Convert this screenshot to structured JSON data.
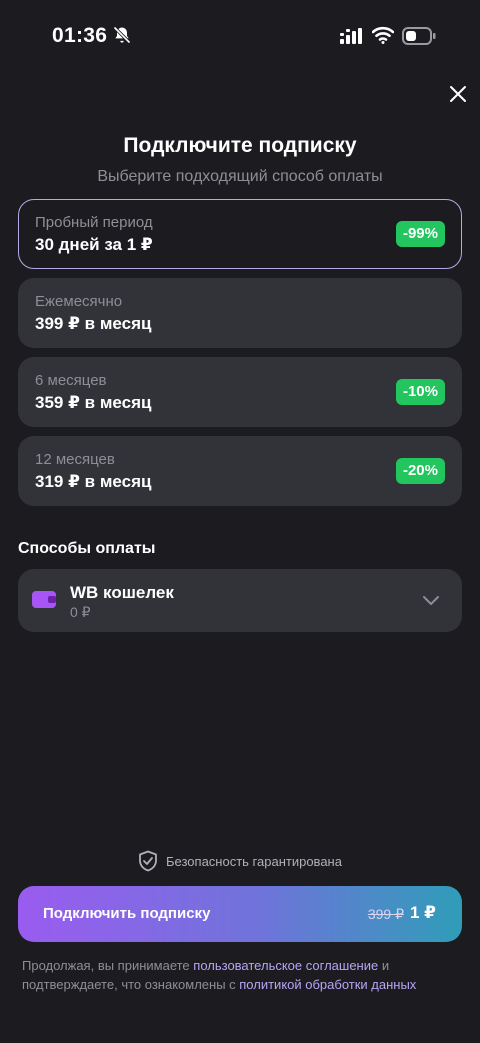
{
  "status_bar": {
    "time": "01:36",
    "icons": [
      "bell-off-icon",
      "signal-icon",
      "wifi-icon",
      "battery-icon"
    ]
  },
  "header": {
    "close_icon": "close-icon",
    "title": "Подключите подписку",
    "subtitle": "Выберите подходящий способ оплаты"
  },
  "plans": [
    {
      "name": "Пробный период",
      "price": "30 дней за 1 ₽",
      "badge": "-99%",
      "selected": true
    },
    {
      "name": "Ежемесячно",
      "price": "399 ₽ в месяц",
      "badge": "",
      "selected": false
    },
    {
      "name": "6 месяцев",
      "price": "359 ₽ в месяц",
      "badge": "-10%",
      "selected": false
    },
    {
      "name": "12 месяцев",
      "price": "319 ₽ в месяц",
      "badge": "-20%",
      "selected": false
    }
  ],
  "payment": {
    "section_title": "Способы оплаты",
    "method_name": "WB кошелек",
    "balance": "0 ₽",
    "icon": "wallet-icon"
  },
  "security": {
    "text": "Безопасность гарантирована",
    "icon": "shield-check-icon"
  },
  "cta": {
    "label": "Подключить подписку",
    "old_price": "399 ₽",
    "price": "1 ₽"
  },
  "legal": {
    "part1": "Продолжая, вы принимаете ",
    "link1": "пользовательское соглашение",
    "part2": " и подтверждаете, что ознакомлены с ",
    "link2": "политикой обработки данных"
  },
  "colors": {
    "background": "#1c1c20",
    "card": "#323239",
    "selected_border": "#b6a7e6",
    "badge": "#22c55e",
    "link": "#b9a4f5",
    "wallet": "#a855f7"
  }
}
